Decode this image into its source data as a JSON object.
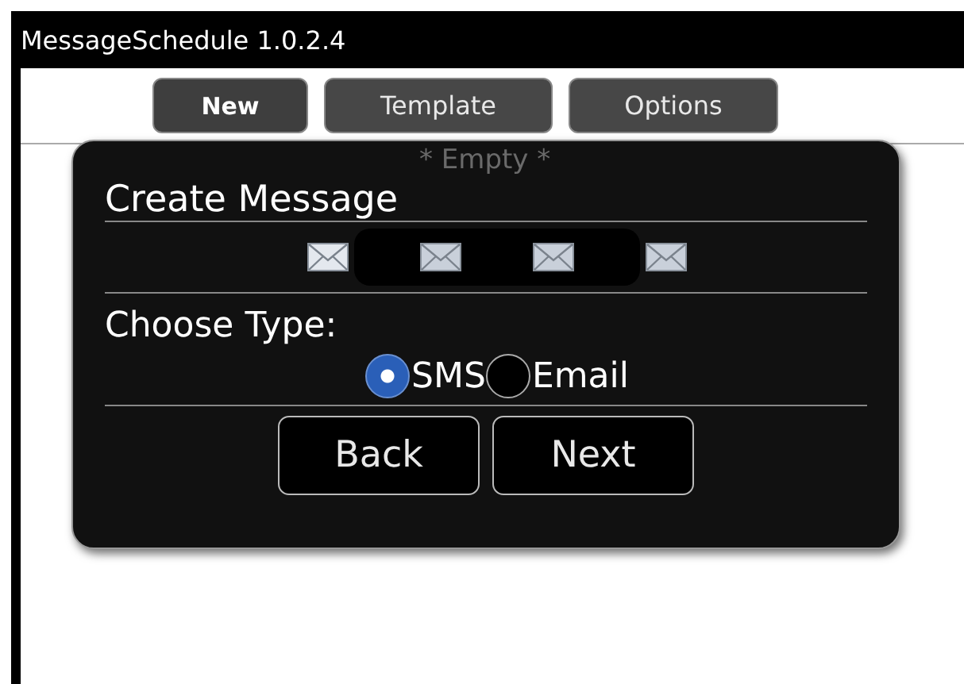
{
  "window": {
    "title": "MessageSchedule 1.0.2.4"
  },
  "toolbar": [
    {
      "label": "New",
      "selected": true
    },
    {
      "label": "Template",
      "selected": false
    },
    {
      "label": "Options",
      "selected": false
    }
  ],
  "list": {
    "empty_text": "* Empty *"
  },
  "dialog": {
    "title": "Create Message",
    "type_label": "Choose Type:",
    "options": [
      {
        "label": "SMS",
        "selected": true
      },
      {
        "label": "Email",
        "selected": false
      }
    ],
    "buttons": [
      "Back",
      "Next"
    ]
  }
}
